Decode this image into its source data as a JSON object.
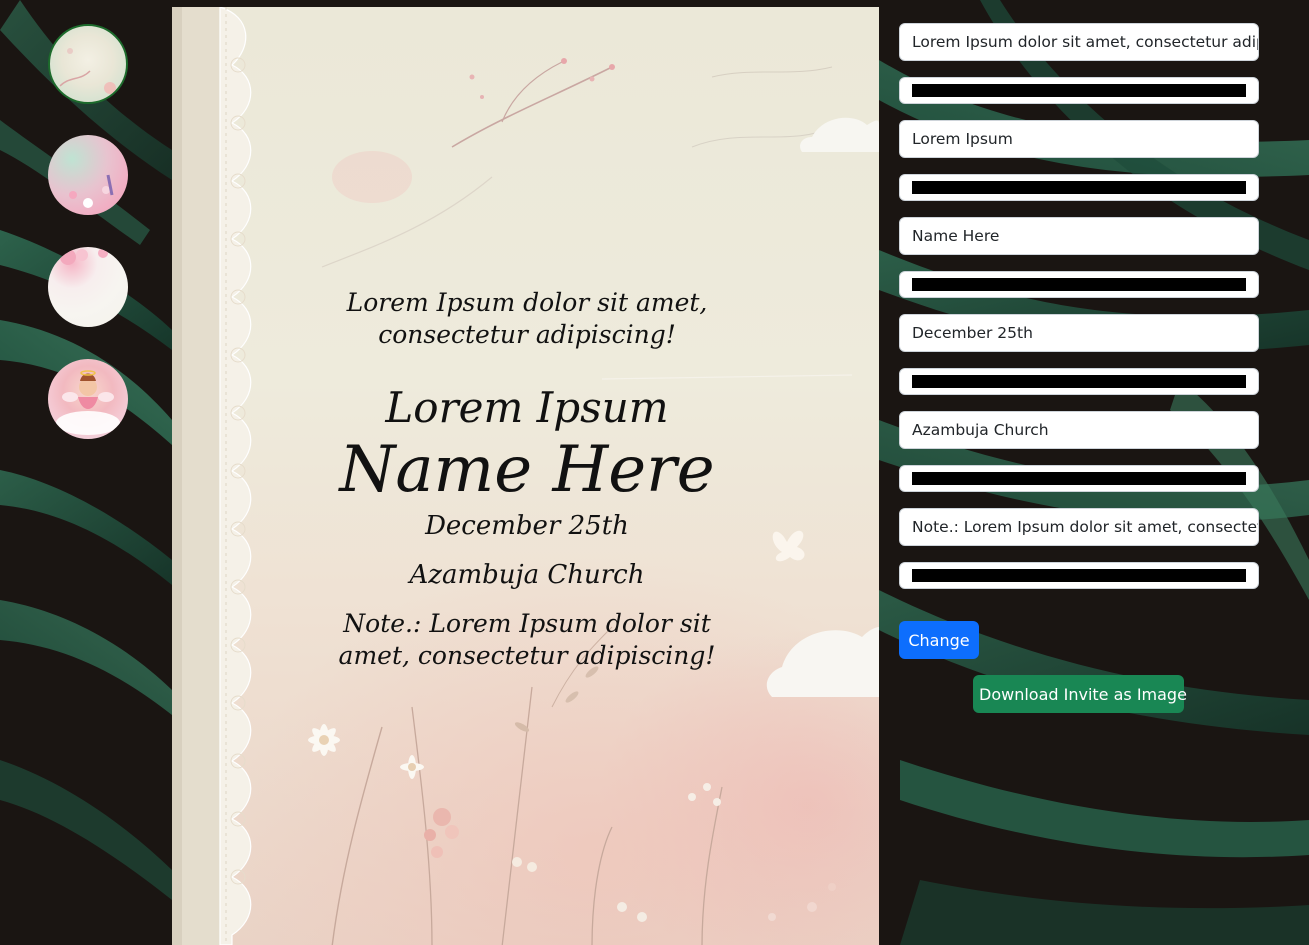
{
  "thumbnails": [
    {
      "icon": "floral-cream-background",
      "selected": true
    },
    {
      "icon": "pink-mint-floral-background",
      "selected": false
    },
    {
      "icon": "white-rose-background",
      "selected": false
    },
    {
      "icon": "angel-cloud-background",
      "selected": false
    }
  ],
  "invite": {
    "intro": "Lorem Ipsum dolor sit amet, consectetur adipiscing!",
    "title": "Lorem Ipsum",
    "name": "Name Here",
    "date": "December 25th",
    "place": "Azambuja Church",
    "note": "Note.: Lorem Ipsum dolor sit amet, consectetur adipiscing!"
  },
  "form": {
    "fields": [
      {
        "value": "Lorem Ipsum dolor sit amet, consectetur adipiscing!",
        "color": "#000000"
      },
      {
        "value": "Lorem Ipsum",
        "color": "#000000"
      },
      {
        "value": "Name Here",
        "color": "#000000"
      },
      {
        "value": "December 25th",
        "color": "#000000"
      },
      {
        "value": "Azambuja Church",
        "color": "#000000"
      },
      {
        "value": "Note.: Lorem Ipsum dolor sit amet, consectetur adipiscing!",
        "color": "#000000"
      }
    ],
    "change_label": "Change",
    "download_label": "Download Invite as Image"
  },
  "colors": {
    "primary": "#0d6efd",
    "success": "#198754",
    "page_background": "#16201b",
    "invite_text": "#111111"
  }
}
